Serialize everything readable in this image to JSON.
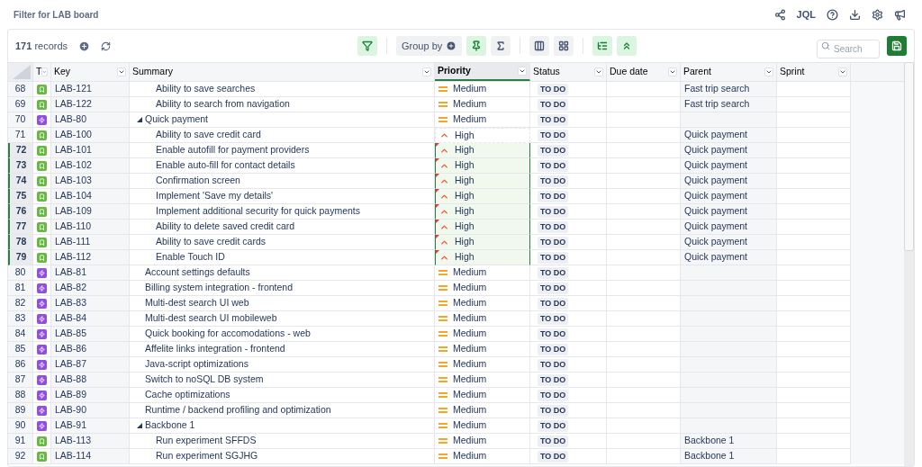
{
  "page_title": "Filter for LAB board",
  "header_actions": [
    {
      "kind": "share"
    },
    {
      "kind": "text",
      "label": "JQL"
    },
    {
      "kind": "help"
    },
    {
      "kind": "download"
    },
    {
      "kind": "settings"
    },
    {
      "kind": "announce"
    }
  ],
  "toolbar": {
    "records": "**171** records",
    "tools": [
      {
        "kind": "filter",
        "active": true
      },
      {
        "kind": "group",
        "label": "Group by",
        "active": false
      },
      {
        "kind": "pin",
        "active": true
      },
      {
        "kind": "sum",
        "active": false
      },
      {
        "kind": "columns",
        "active": false
      },
      {
        "kind": "grid",
        "active": false
      },
      {
        "kind": "tree",
        "active": true
      },
      {
        "kind": "collapse",
        "active": true
      }
    ],
    "search": {
      "placeholder": "Search"
    }
  },
  "table": {
    "columns": [
      {
        "label": "T",
        "selected": false
      },
      {
        "label": "Key",
        "selected": false
      },
      {
        "label": "Summary",
        "selected": false
      },
      {
        "label": "Priority",
        "selected": true
      },
      {
        "label": "Status",
        "selected": false
      },
      {
        "label": "Due date",
        "selected": false
      },
      {
        "label": "Parent",
        "selected": false
      },
      {
        "label": "Sprint",
        "selected": false
      }
    ],
    "rows": [
      {
        "children": [
          {
            "number": "68",
            "kind": "story",
            "key": "LAB-121",
            "summary": "Ability to save searches",
            "priority": {
              "label": "Medium",
              "kind": "medium"
            },
            "status": "TO DO",
            "parent": "Fast trip search",
            "selected": false,
            "copied": false,
            "edited": false
          },
          {
            "number": "69",
            "kind": "story",
            "key": "LAB-122",
            "summary": "Ability to search from navigation",
            "priority": {
              "label": "Medium",
              "kind": "medium"
            },
            "status": "TO DO",
            "parent": "Fast trip search",
            "selected": false,
            "copied": false,
            "edited": false
          }
        ]
      },
      {
        "number": "70",
        "kind": "epic",
        "key": "LAB-80",
        "summary": "Quick payment",
        "priority": {
          "label": "Medium",
          "kind": "medium"
        },
        "status": "TO DO",
        "selected": false,
        "copied": false,
        "edited": false,
        "expanded": true,
        "children": [
          {
            "number": "71",
            "kind": "story",
            "key": "LAB-100",
            "summary": "Ability to save credit card",
            "priority": {
              "label": "High",
              "kind": "high"
            },
            "status": "TO DO",
            "parent": "Quick payment",
            "selected": false,
            "copied": true,
            "edited": false
          },
          {
            "number": "72",
            "kind": "story",
            "key": "LAB-101",
            "summary": "Enable autofill for payment providers",
            "priority": {
              "label": "High",
              "kind": "high"
            },
            "status": "TO DO",
            "parent": "Quick payment",
            "selected": true,
            "copied": false,
            "edited": true
          },
          {
            "number": "73",
            "kind": "story",
            "key": "LAB-102",
            "summary": "Enable auto-fill for contact details",
            "priority": {
              "label": "High",
              "kind": "high"
            },
            "status": "TO DO",
            "parent": "Quick payment",
            "selected": true,
            "copied": false,
            "edited": true
          },
          {
            "number": "74",
            "kind": "story",
            "key": "LAB-103",
            "summary": "Confirmation screen",
            "priority": {
              "label": "High",
              "kind": "high"
            },
            "status": "TO DO",
            "parent": "Quick payment",
            "selected": true,
            "copied": false,
            "edited": true
          },
          {
            "number": "75",
            "kind": "story",
            "key": "LAB-104",
            "summary": "Implement 'Save my details'",
            "priority": {
              "label": "High",
              "kind": "high"
            },
            "status": "TO DO",
            "parent": "Quick payment",
            "selected": true,
            "copied": false,
            "edited": true
          },
          {
            "number": "76",
            "kind": "story",
            "key": "LAB-109",
            "summary": "Implement additional security for quick payments",
            "priority": {
              "label": "High",
              "kind": "high"
            },
            "status": "TO DO",
            "parent": "Quick payment",
            "selected": true,
            "copied": false,
            "edited": true
          },
          {
            "number": "77",
            "kind": "story",
            "key": "LAB-110",
            "summary": "Ability to delete saved credit card",
            "priority": {
              "label": "High",
              "kind": "high"
            },
            "status": "TO DO",
            "parent": "Quick payment",
            "selected": true,
            "copied": false,
            "edited": true
          },
          {
            "number": "78",
            "kind": "story",
            "key": "LAB-111",
            "summary": "Ability to save credit cards",
            "priority": {
              "label": "High",
              "kind": "high"
            },
            "status": "TO DO",
            "parent": "Quick payment",
            "selected": true,
            "copied": false,
            "edited": true
          },
          {
            "number": "79",
            "kind": "story",
            "key": "LAB-112",
            "summary": "Enable Touch ID",
            "priority": {
              "label": "High",
              "kind": "high"
            },
            "status": "TO DO",
            "parent": "Quick payment",
            "selected": true,
            "copied": false,
            "edited": true
          }
        ]
      },
      {
        "number": "80",
        "kind": "epic",
        "key": "LAB-81",
        "summary": "Account settings defaults",
        "priority": {
          "label": "Medium",
          "kind": "medium"
        },
        "status": "TO DO",
        "selected": false,
        "copied": false,
        "edited": false
      },
      {
        "number": "81",
        "kind": "epic",
        "key": "LAB-82",
        "summary": "Billing system integration - frontend",
        "priority": {
          "label": "Medium",
          "kind": "medium"
        },
        "status": "TO DO",
        "selected": false,
        "copied": false,
        "edited": false
      },
      {
        "number": "82",
        "kind": "epic",
        "key": "LAB-83",
        "summary": "Multi-dest search UI web",
        "priority": {
          "label": "Medium",
          "kind": "medium"
        },
        "status": "TO DO",
        "selected": false,
        "copied": false,
        "edited": false
      },
      {
        "number": "83",
        "kind": "epic",
        "key": "LAB-84",
        "summary": "Multi-dest search UI mobileweb",
        "priority": {
          "label": "Medium",
          "kind": "medium"
        },
        "status": "TO DO",
        "selected": false,
        "copied": false,
        "edited": false
      },
      {
        "number": "84",
        "kind": "epic",
        "key": "LAB-85",
        "summary": "Quick booking for accomodations - web",
        "priority": {
          "label": "Medium",
          "kind": "medium"
        },
        "status": "TO DO",
        "selected": false,
        "copied": false,
        "edited": false
      },
      {
        "number": "85",
        "kind": "epic",
        "key": "LAB-86",
        "summary": "Affelite links integration - frontend",
        "priority": {
          "label": "Medium",
          "kind": "medium"
        },
        "status": "TO DO",
        "selected": false,
        "copied": false,
        "edited": false
      },
      {
        "number": "86",
        "kind": "epic",
        "key": "LAB-87",
        "summary": "Java-script optimizations",
        "priority": {
          "label": "Medium",
          "kind": "medium"
        },
        "status": "TO DO",
        "selected": false,
        "copied": false,
        "edited": false
      },
      {
        "number": "87",
        "kind": "epic",
        "key": "LAB-88",
        "summary": "Switch to noSQL DB system",
        "priority": {
          "label": "Medium",
          "kind": "medium"
        },
        "status": "TO DO",
        "selected": false,
        "copied": false,
        "edited": false
      },
      {
        "number": "88",
        "kind": "epic",
        "key": "LAB-89",
        "summary": "Cache optimizations",
        "priority": {
          "label": "Medium",
          "kind": "medium"
        },
        "status": "TO DO",
        "selected": false,
        "copied": false,
        "edited": false
      },
      {
        "number": "89",
        "kind": "epic",
        "key": "LAB-90",
        "summary": "Runtime / backend profiling and optimization",
        "priority": {
          "label": "Medium",
          "kind": "medium"
        },
        "status": "TO DO",
        "selected": false,
        "copied": false,
        "edited": false
      },
      {
        "number": "90",
        "kind": "epic",
        "key": "LAB-91",
        "summary": "Backbone 1",
        "priority": {
          "label": "Medium",
          "kind": "medium"
        },
        "status": "TO DO",
        "selected": false,
        "copied": false,
        "edited": false,
        "expanded": true,
        "children": [
          {
            "number": "91",
            "kind": "story",
            "key": "LAB-113",
            "summary": "Run experiment SFFDS",
            "priority": {
              "label": "Medium",
              "kind": "medium"
            },
            "status": "TO DO",
            "parent": "Backbone 1",
            "selected": false,
            "copied": false,
            "edited": false
          },
          {
            "number": "92",
            "kind": "story",
            "key": "LAB-114",
            "summary": "Run experiment SGJHG",
            "priority": {
              "label": "Medium",
              "kind": "medium"
            },
            "status": "TO DO",
            "parent": "Backbone 1",
            "selected": false,
            "copied": false,
            "edited": false
          }
        ]
      }
    ]
  }
}
